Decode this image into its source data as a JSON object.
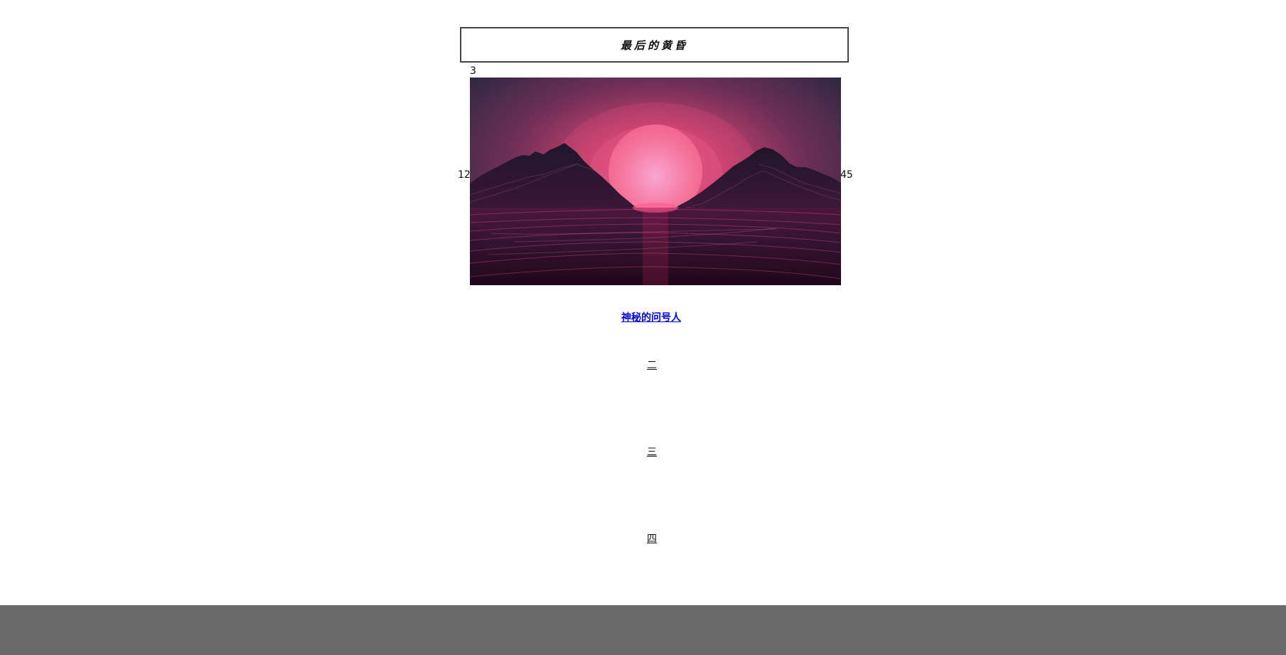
{
  "title": "最后的黄昏",
  "hero": {
    "top_number": "3",
    "left_number": "12",
    "right_number": "45",
    "image_name": "synthwave-sunset-image"
  },
  "link": {
    "label": "神秘的问号人"
  },
  "nav": {
    "item_two": "二",
    "item_three": "三",
    "item_four": "四"
  },
  "colors": {
    "link": "#0000ee",
    "footer": "#6a6a6a",
    "sun": "#f06292",
    "sky_top": "#27273f",
    "ground": "#2b0d26"
  }
}
